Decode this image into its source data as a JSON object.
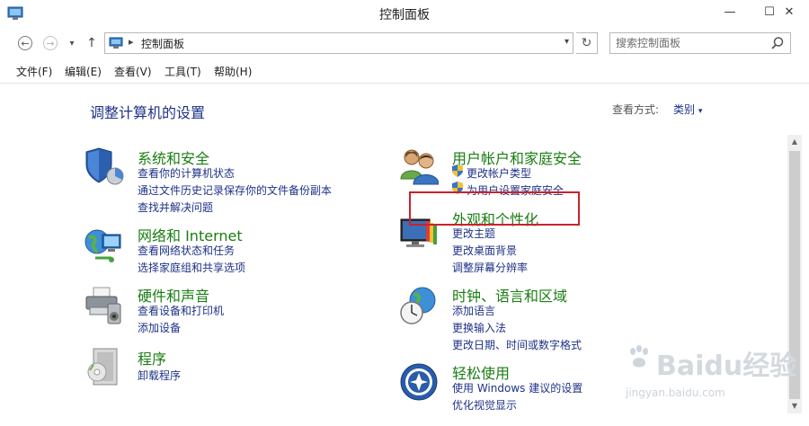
{
  "window": {
    "title": "控制面板",
    "minimize_glyph": "—",
    "maximize_glyph": "☐",
    "close_glyph": "✕"
  },
  "nav": {
    "back_glyph": "←",
    "forward_glyph": "→",
    "recent_glyph": "▾",
    "up_glyph": "↑",
    "address_separator": "▸",
    "address": "控制面板",
    "address_dropdown_glyph": "▾",
    "refresh_glyph": "↻",
    "search_placeholder": "搜索控制面板"
  },
  "menu": [
    "文件(F)",
    "编辑(E)",
    "查看(V)",
    "工具(T)",
    "帮助(H)"
  ],
  "page": {
    "title": "调整计算机的设置",
    "view_by_label": "查看方式:",
    "view_by_value": "类别",
    "view_by_arrow": "▾"
  },
  "categories": {
    "system_security": {
      "title": "系统和安全",
      "links": [
        "查看你的计算机状态",
        "通过文件历史记录保存你的文件备份副本",
        "查找并解决问题"
      ]
    },
    "network": {
      "title": "网络和 Internet",
      "links": [
        "查看网络状态和任务",
        "选择家庭组和共享选项"
      ]
    },
    "hardware": {
      "title": "硬件和声音",
      "links": [
        "查看设备和打印机",
        "添加设备"
      ]
    },
    "programs": {
      "title": "程序",
      "links": [
        "卸载程序"
      ]
    },
    "user_accounts": {
      "title": "用户帐户和家庭安全",
      "links": [
        "更改帐户类型",
        "为用户设置家庭安全"
      ]
    },
    "appearance": {
      "title": "外观和个性化",
      "links": [
        "更改主题",
        "更改桌面背景",
        "调整屏幕分辨率"
      ]
    },
    "clock": {
      "title": "时钟、语言和区域",
      "links": [
        "添加语言",
        "更换输入法",
        "更改日期、时间或数字格式"
      ]
    },
    "ease": {
      "title": "轻松使用",
      "links": [
        "使用 Windows 建议的设置",
        "优化视觉显示"
      ]
    }
  },
  "scrollbar": {
    "up_glyph": "▲",
    "down_glyph": "▼"
  },
  "watermark": {
    "brand": "Baidu经验",
    "url": "jingyan.baidu.com"
  },
  "colors": {
    "category_title": "#1a7d12",
    "link": "#1e3287",
    "highlight_box": "#c8232c"
  }
}
